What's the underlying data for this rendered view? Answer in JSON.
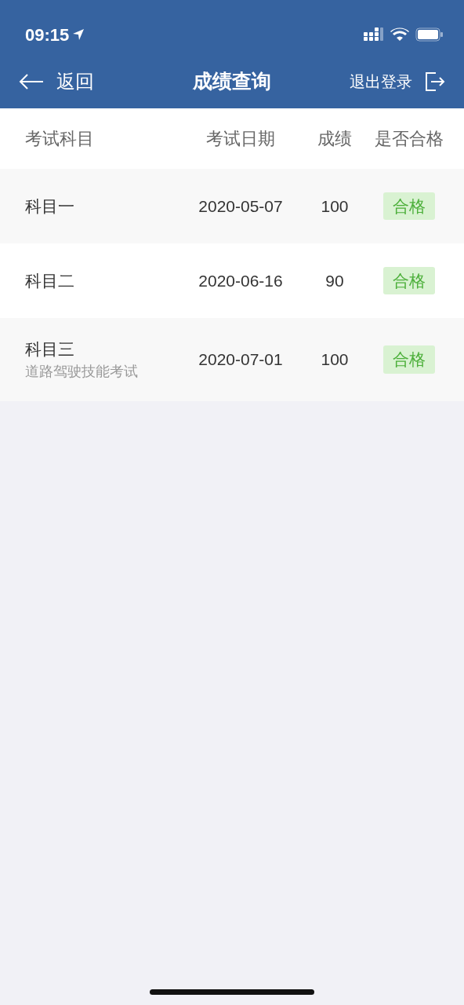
{
  "status_bar": {
    "time": "09:15"
  },
  "nav": {
    "back": "返回",
    "title": "成绩查询",
    "logout": "退出登录"
  },
  "table": {
    "columns": [
      "考试科目",
      "考试日期",
      "成绩",
      "是否合格"
    ],
    "rows": [
      {
        "subject": "科目一",
        "date": "2020-05-07",
        "score": "100",
        "result": "合格",
        "passed": true
      },
      {
        "subject": "科目二",
        "date": "2020-06-16",
        "score": "90",
        "result": "合格",
        "passed": true
      },
      {
        "subject": "科目三",
        "note": "道路驾驶技能考试",
        "date": "2020-07-01",
        "score": "100",
        "result": "合格",
        "passed": true
      }
    ]
  }
}
